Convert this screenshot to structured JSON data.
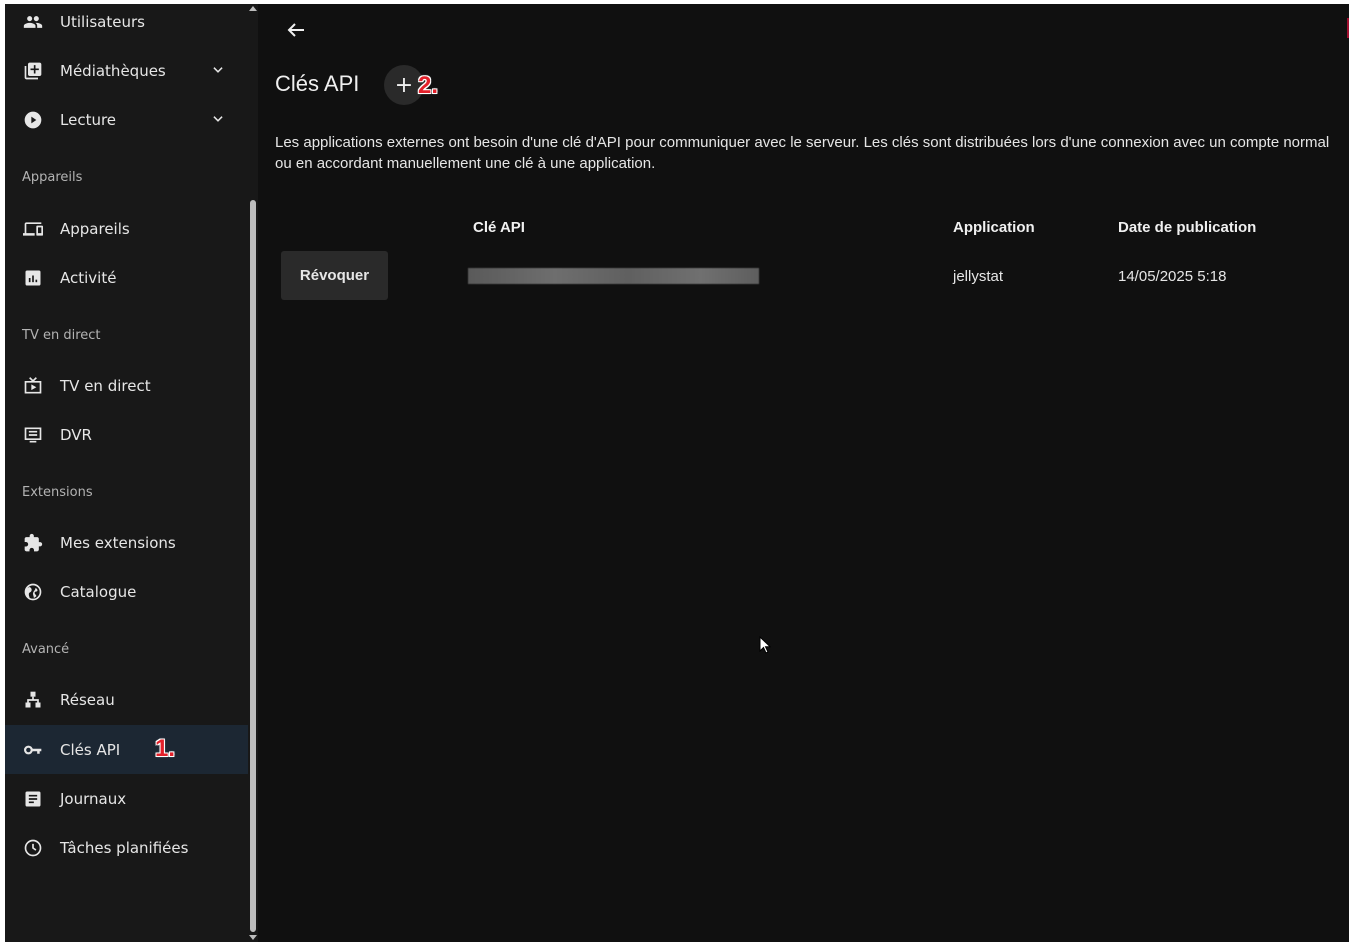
{
  "sidebar": {
    "items": [
      {
        "id": "utilisateurs",
        "label": "Utilisateurs",
        "icon": "users-icon"
      },
      {
        "id": "mediatheques",
        "label": "Médiathèques",
        "icon": "library-add-icon",
        "expandable": true
      },
      {
        "id": "lecture",
        "label": "Lecture",
        "icon": "play-circle-icon",
        "expandable": true
      },
      {
        "id": "appareils",
        "label": "Appareils",
        "icon": "devices-icon"
      },
      {
        "id": "activite",
        "label": "Activité",
        "icon": "analytics-icon"
      },
      {
        "id": "tv-en-direct",
        "label": "TV en direct",
        "icon": "live-tv-icon"
      },
      {
        "id": "dvr",
        "label": "DVR",
        "icon": "dvr-icon"
      },
      {
        "id": "mes-extensions",
        "label": "Mes extensions",
        "icon": "puzzle-icon"
      },
      {
        "id": "catalogue",
        "label": "Catalogue",
        "icon": "globe-icon"
      },
      {
        "id": "reseau",
        "label": "Réseau",
        "icon": "network-icon"
      },
      {
        "id": "cles-api",
        "label": "Clés API",
        "icon": "key-icon",
        "active": true
      },
      {
        "id": "journaux",
        "label": "Journaux",
        "icon": "article-icon"
      },
      {
        "id": "taches-planifiees",
        "label": "Tâches planifiées",
        "icon": "clock-icon"
      }
    ],
    "sections": {
      "appareils": "Appareils",
      "tv_en_direct": "TV en direct",
      "extensions": "Extensions",
      "avance": "Avancé"
    }
  },
  "annotations": {
    "step1": "1.",
    "step2": "2."
  },
  "main": {
    "title": "Clés API",
    "add_label": "+",
    "description": "Les applications externes ont besoin d'une clé d'API pour communiquer avec le serveur. Les clés sont distribuées lors d'une connexion avec un compte normal ou en accordant manuellement une clé à une application.",
    "table": {
      "headers": {
        "key": "Clé API",
        "application": "Application",
        "date": "Date de publication"
      },
      "rows": [
        {
          "revoke_label": "Révoquer",
          "application": "jellystat",
          "date": "14/05/2025 5:18"
        }
      ]
    }
  },
  "colors": {
    "background": "#101010",
    "sidebar": "#181818",
    "active_item": "#1c2733",
    "annotation": "#e2202a"
  }
}
